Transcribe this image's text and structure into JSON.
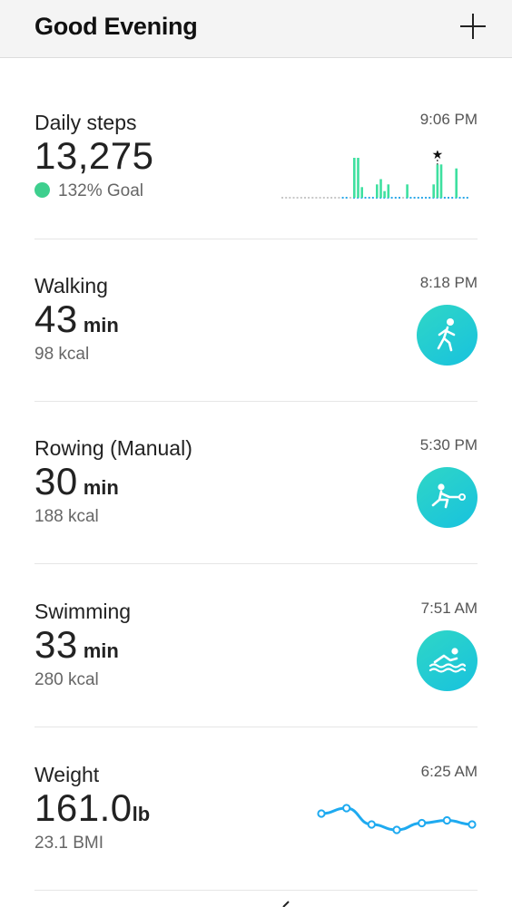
{
  "header": {
    "title": "Good Evening",
    "add_icon": "plus-icon"
  },
  "steps": {
    "title": "Daily steps",
    "time": "9:06 PM",
    "value": "13,275",
    "goal_text": "132% Goal",
    "goal_color": "#3ecf8e",
    "chart_data": {
      "type": "bar",
      "values": [
        0,
        0,
        0,
        0,
        0,
        0,
        0,
        0,
        0,
        0,
        0,
        0,
        0,
        0,
        0,
        0,
        0.02,
        0.02,
        0,
        0.3,
        0.3,
        0.08,
        0.02,
        0.02,
        0.02,
        0.1,
        0.14,
        0.05,
        0.1,
        0.03,
        0.02,
        0.02,
        0,
        0.1,
        0.02,
        0.02,
        0.02,
        0.02,
        0.02,
        0.02,
        0.1,
        0.25,
        0.25,
        0.02,
        0.02,
        0.02,
        0.22,
        0.02,
        0.02,
        0.02
      ],
      "peak_marker": "star",
      "bar_color": "#3ee0a0",
      "baseline_color": "#2ba8e8"
    }
  },
  "activities": [
    {
      "title": "Walking",
      "time": "8:18 PM",
      "value": "43",
      "unit": "min",
      "sub": "98 kcal",
      "icon": "walking-icon"
    },
    {
      "title": "Rowing (Manual)",
      "time": "5:30 PM",
      "value": "30",
      "unit": "min",
      "sub": "188 kcal",
      "icon": "rowing-icon"
    },
    {
      "title": "Swimming",
      "time": "7:51 AM",
      "value": "33",
      "unit": "min",
      "sub": "280 kcal",
      "icon": "swimming-icon"
    }
  ],
  "weight": {
    "title": "Weight",
    "time": "6:25 AM",
    "value": "161.0",
    "unit": "lb",
    "sub": "23.1 BMI",
    "chart_data": {
      "type": "line",
      "values": [
        162.2,
        162.6,
        161.4,
        161.0,
        161.5,
        161.7,
        161.4
      ],
      "line_color": "#1eaaf0"
    }
  }
}
